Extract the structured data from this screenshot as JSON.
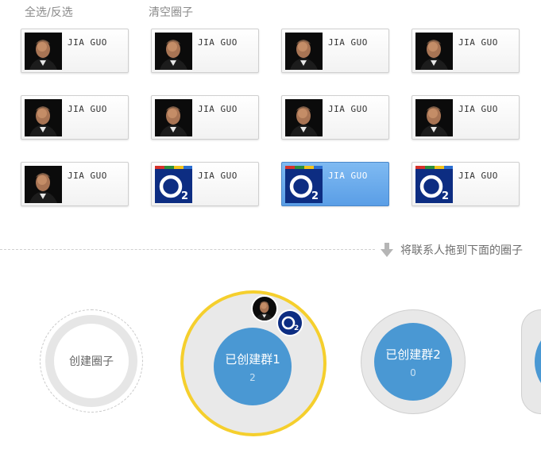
{
  "toolbar": {
    "select_all": "全选/反选",
    "clear_circle": "清空圈子"
  },
  "contacts": [
    {
      "name": "JIA GUO",
      "avatar": "portrait",
      "selected": false
    },
    {
      "name": "JIA GUO",
      "avatar": "portrait",
      "selected": false
    },
    {
      "name": "JIA GUO",
      "avatar": "portrait",
      "selected": false
    },
    {
      "name": "JIA GUO",
      "avatar": "portrait",
      "selected": false
    },
    {
      "name": "JIA GUO",
      "avatar": "portrait",
      "selected": false
    },
    {
      "name": "JIA GUO",
      "avatar": "portrait",
      "selected": false
    },
    {
      "name": "JIA GUO",
      "avatar": "portrait",
      "selected": false
    },
    {
      "name": "JIA GUO",
      "avatar": "portrait",
      "selected": false
    },
    {
      "name": "JIA GUO",
      "avatar": "portrait",
      "selected": false
    },
    {
      "name": "JIA GUO",
      "avatar": "o2-logo",
      "selected": false
    },
    {
      "name": "JIA GUO",
      "avatar": "o2-logo",
      "selected": true
    },
    {
      "name": "JIA GUO",
      "avatar": "o2-logo",
      "selected": false
    }
  ],
  "hint": {
    "text": "将联系人拖到下面的圈子",
    "icon": "arrow-down-icon"
  },
  "circles": {
    "create_label": "创建圈子",
    "groups": [
      {
        "name": "已创建群1",
        "count": "2",
        "members": [
          "portrait",
          "o2-logo"
        ]
      },
      {
        "name": "已创建群2",
        "count": "0"
      }
    ]
  },
  "colors": {
    "accent_blue": "#4a98d3",
    "selected_card": "#6aa9ec",
    "highlight_ring": "#f5cf2d"
  }
}
